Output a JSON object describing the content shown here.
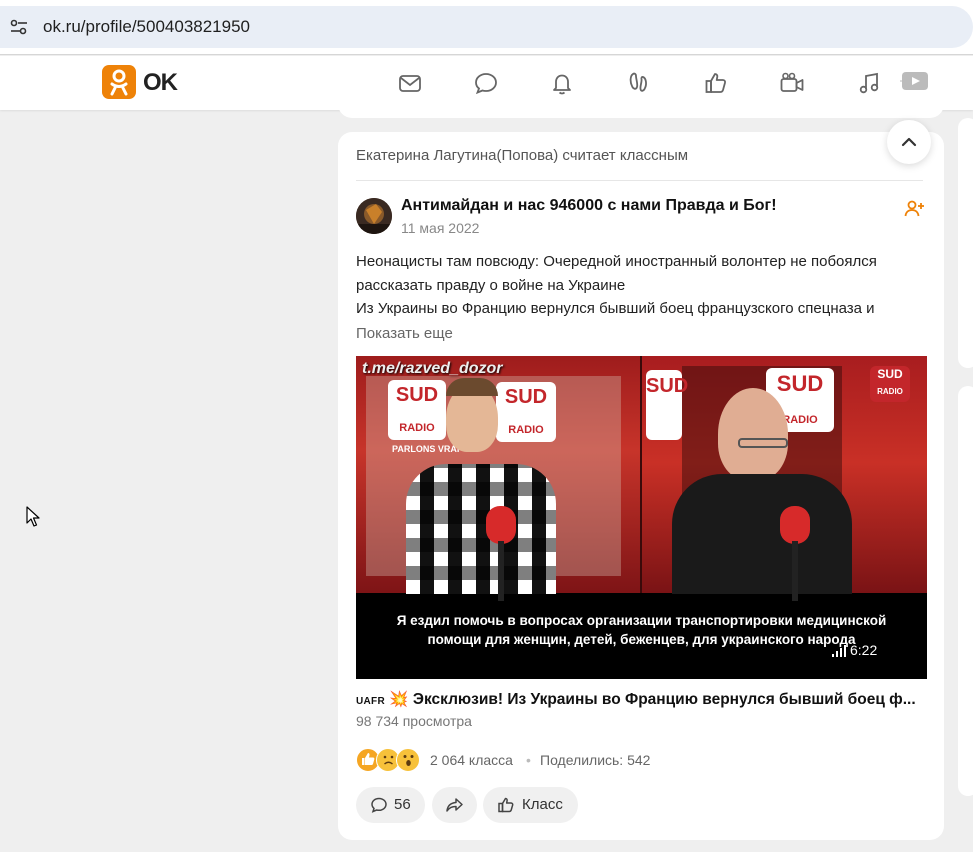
{
  "browser": {
    "url": "ok.ru/profile/500403821950",
    "site_info_icon": "tune-icon"
  },
  "header": {
    "logo_text": "OK",
    "nav_icons": [
      "mail-icon",
      "chat-icon",
      "bell-icon",
      "guests-icon",
      "like-icon",
      "video-camera-icon",
      "music-icon",
      "video-play-icon"
    ]
  },
  "post": {
    "context_line": "Екатерина Лагутина(Попова) считает классным",
    "author": "Антимайдан и нас 946000 с нами Правда и Бог!",
    "date": "11 мая 2022",
    "text_line1": "Неонацисты там повсюду: Очередной иностранный волонтер не побоялся",
    "text_line2": "рассказать правду о войне на Украине",
    "text_line3": "Из Украины во Францию вернулся бывший боец французского спецназа и",
    "show_more": "Показать еще",
    "video": {
      "watermark": "t.me/razved_dozor",
      "subtitle_line1": "Я ездил помочь в вопросах  организации транспортировки  медицинской",
      "subtitle_line2": "помощи  для женщин, детей, беженцев, для украинского народа",
      "duration": "6:22",
      "sign_text_1": "SUD",
      "sign_text_2": "RADIO",
      "sign_text_3": "PARLONS VRAI"
    },
    "video_tag": "UAFR",
    "video_title": "Эксклюзив! Из Украины во Францию вернулся бывший боец ф...",
    "views": "98 734 просмотра",
    "reactions": {
      "class_count": "2 064 класса",
      "separator": "•",
      "shared": "Поделились: 542"
    },
    "actions": {
      "comments": "56",
      "class_label": "Класс"
    }
  },
  "colors": {
    "brand": "#ee8208",
    "background": "#efefef"
  }
}
